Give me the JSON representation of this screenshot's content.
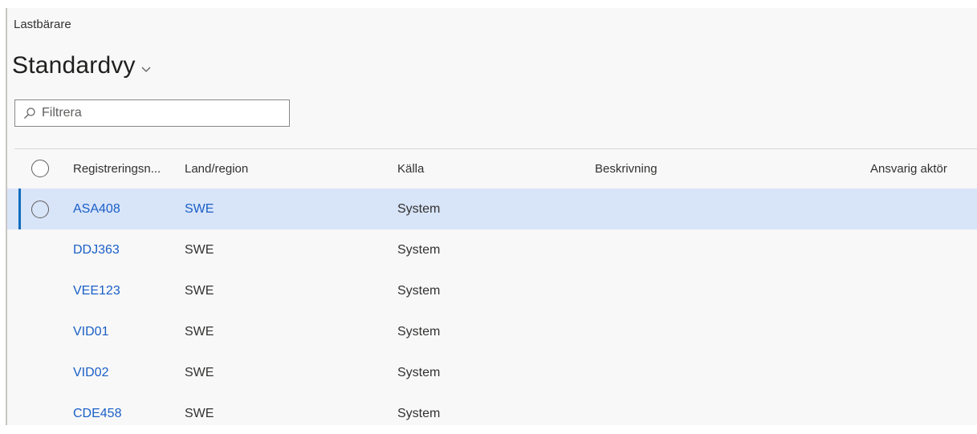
{
  "breadcrumb": "Lastbärare",
  "view_title": "Standardvy",
  "filter": {
    "placeholder": "Filtrera",
    "value": ""
  },
  "columns": {
    "reg": "Registreringsn...",
    "land": "Land/region",
    "kalla": "Källa",
    "beskrivning": "Beskrivning",
    "ansvarig": "Ansvarig aktör"
  },
  "rows": [
    {
      "reg": "ASA408",
      "land": "SWE",
      "kalla": "System",
      "beskrivning": "",
      "ansvarig": ""
    },
    {
      "reg": "DDJ363",
      "land": "SWE",
      "kalla": "System",
      "beskrivning": "",
      "ansvarig": ""
    },
    {
      "reg": "VEE123",
      "land": "SWE",
      "kalla": "System",
      "beskrivning": "",
      "ansvarig": ""
    },
    {
      "reg": "VID01",
      "land": "SWE",
      "kalla": "System",
      "beskrivning": "",
      "ansvarig": ""
    },
    {
      "reg": "VID02",
      "land": "SWE",
      "kalla": "System",
      "beskrivning": "",
      "ansvarig": ""
    },
    {
      "reg": "CDE458",
      "land": "SWE",
      "kalla": "System",
      "beskrivning": "",
      "ansvarig": ""
    }
  ],
  "selected_row": 0,
  "colors": {
    "link": "#1a5fc7",
    "selected_row_bg": "#d8e4f8",
    "selected_row_accent": "#0f6cbd"
  },
  "icons": {
    "title_chevron": "chevron-down-icon",
    "filter": "search-icon",
    "row_select": "radio-circle-icon"
  }
}
